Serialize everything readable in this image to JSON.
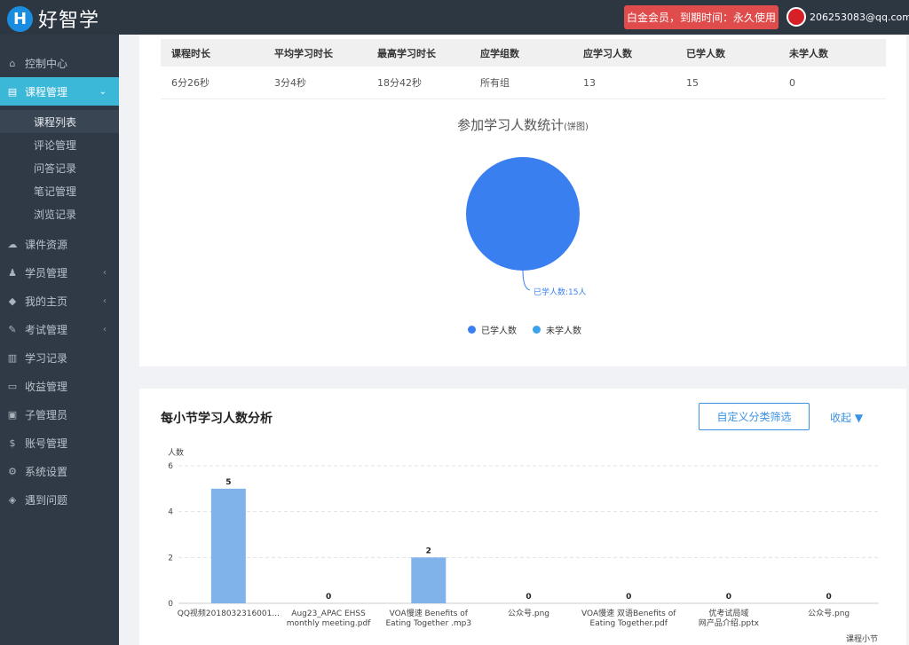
{
  "header": {
    "logo_letter": "H",
    "logo_text": "好智学",
    "member_badge": "白金会员，到期时间：永久使用",
    "user_email": "206253083@qq.com",
    "caret": "﹀"
  },
  "sidebar": {
    "items": [
      {
        "label": "控制中心",
        "icon": "home-icon",
        "glyph": "⌂"
      },
      {
        "label": "课程管理",
        "icon": "book-icon",
        "glyph": "▤"
      },
      {
        "label": "课件资源",
        "icon": "cloud-icon",
        "glyph": "☁"
      },
      {
        "label": "学员管理",
        "icon": "users-icon",
        "glyph": "♟"
      },
      {
        "label": "我的主页",
        "icon": "graduation-icon",
        "glyph": "◆"
      },
      {
        "label": "考试管理",
        "icon": "tag-icon",
        "glyph": "✎"
      },
      {
        "label": "学习记录",
        "icon": "book-open-icon",
        "glyph": "▥"
      },
      {
        "label": "收益管理",
        "icon": "card-icon",
        "glyph": "▭"
      },
      {
        "label": "子管理员",
        "icon": "lock-icon",
        "glyph": "▣"
      },
      {
        "label": "账号管理",
        "icon": "dollar-icon",
        "glyph": "$"
      },
      {
        "label": "系统设置",
        "icon": "gear-icon",
        "glyph": "⚙"
      },
      {
        "label": "遇到问题",
        "icon": "tag-alt-icon",
        "glyph": "◈"
      }
    ],
    "sub_items": [
      "课程列表",
      "评论管理",
      "问答记录",
      "笔记管理",
      "浏览记录"
    ],
    "arrow_right": "‹",
    "arrow_down": "⌄"
  },
  "stats": {
    "headers": [
      "课程时长",
      "平均学习时长",
      "最高学习时长",
      "应学组数",
      "应学习人数",
      "已学人数",
      "未学人数"
    ],
    "values": [
      "6分26秒",
      "3分4秒",
      "18分42秒",
      "所有组",
      "13",
      "15",
      "0"
    ]
  },
  "pie": {
    "title": "参加学习人数统计",
    "title_suffix": "(饼图)",
    "label": "已学人数:15人",
    "legend": [
      "已学人数",
      "未学人数"
    ],
    "values": [
      15,
      0
    ],
    "colors": [
      "#3a7ff0",
      "#3ba2f0"
    ]
  },
  "section2": {
    "title": "每小节学习人数分析",
    "filter_button": "自定义分类筛选",
    "collapse": "收起 ▼"
  },
  "chart_data": {
    "type": "bar",
    "ylabel": "人数",
    "xlabel": "课程小节",
    "ylim": [
      0,
      6
    ],
    "yticks": [
      0,
      2,
      4,
      6
    ],
    "categories": [
      [
        "QQ视频2018032316001..."
      ],
      [
        "Aug23_APAC EHSS",
        "monthly meeting.pdf"
      ],
      [
        "VOA慢速 Benefits of",
        "Eating Together .mp3"
      ],
      [
        "公众号.png"
      ],
      [
        "VOA慢速 双语Benefits of",
        "Eating Together.pdf"
      ],
      [
        "优考试局域",
        "网产品介绍.pptx"
      ],
      [
        "公众号.png"
      ]
    ],
    "values": [
      5,
      0,
      2,
      0,
      0,
      0,
      0
    ],
    "bar_color": "#7fb3ea"
  }
}
